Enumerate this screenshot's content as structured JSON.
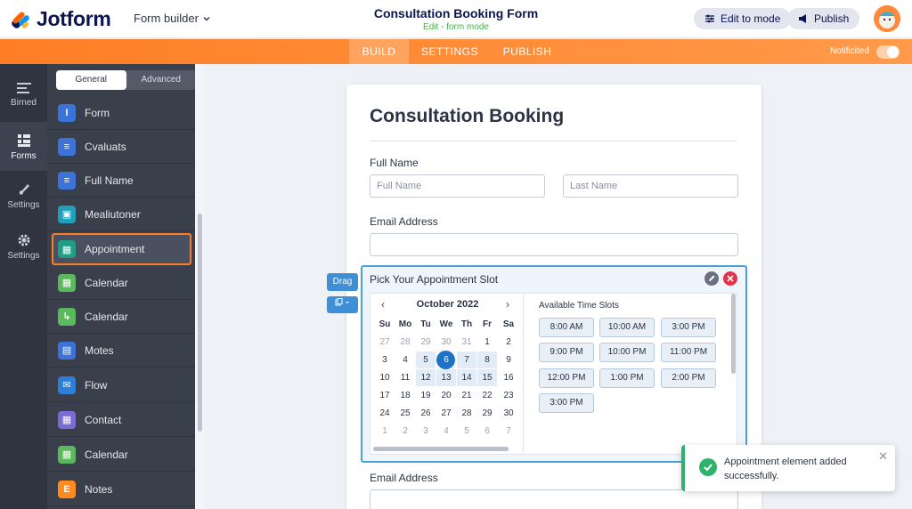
{
  "header": {
    "logo_text": "Jotform",
    "form_builder": "Form builder",
    "title": "Consultation Booking Form",
    "subtitle": "Edit - form mode",
    "edit_mode_button": "Edit to mode",
    "publish_button": "Publish"
  },
  "topbar": {
    "tabs": [
      "BUILD",
      "SETTINGS",
      "PUBLISH"
    ],
    "active_tab": "BUILD",
    "notification_label": "Notificited",
    "accent": "#ff7e25"
  },
  "rail": {
    "items": [
      "Birned",
      "Forms",
      "Settings",
      "Settings"
    ],
    "active": "Forms"
  },
  "panel": {
    "tabs": [
      "General",
      "Advanced"
    ],
    "active_tab": "General",
    "items": [
      {
        "label": "Form",
        "icon": "text-cursor-icon",
        "color": "#3b73d8",
        "glyph": "I"
      },
      {
        "label": "Cvaluats",
        "icon": "list-icon",
        "color": "#3b73d8",
        "glyph": "≡"
      },
      {
        "label": "Full Name",
        "icon": "lines-icon",
        "color": "#3b73d8",
        "glyph": "≡"
      },
      {
        "label": "Mealiutoner",
        "icon": "image-icon",
        "color": "#1ea0b8",
        "glyph": "▣"
      },
      {
        "label": "Appointment",
        "icon": "calendar-icon",
        "color": "#1f9e84",
        "glyph": "▦"
      },
      {
        "label": "Calendar",
        "icon": "calendar-icon",
        "color": "#5cb85c",
        "glyph": "▦"
      },
      {
        "label": "Calendar",
        "icon": "phone-icon",
        "color": "#5cb85c",
        "glyph": "↳"
      },
      {
        "label": "Motes",
        "icon": "note-icon",
        "color": "#3b73d8",
        "glyph": "▤"
      },
      {
        "label": "Flow",
        "icon": "mail-icon",
        "color": "#2e7fd8",
        "glyph": "✉"
      },
      {
        "label": "Contact",
        "icon": "calendar-check-icon",
        "color": "#7b6bd6",
        "glyph": "▦"
      },
      {
        "label": "Calendar",
        "icon": "calendar-icon",
        "color": "#5cb85c",
        "glyph": "▦"
      },
      {
        "label": "Notes",
        "icon": "letter-e-icon",
        "color": "#ff8a1e",
        "glyph": "E"
      }
    ],
    "selected": "Appointment"
  },
  "form": {
    "title": "Consultation Booking",
    "full_name_label": "Full Name",
    "first_placeholder": "Full Name",
    "last_placeholder": "Last Name",
    "email_label": "Email Address",
    "email_label_2": "Email Address"
  },
  "appointment": {
    "title": "Pick Your Appointment Slot",
    "drag_label": "Drag",
    "month": "October 2022",
    "weekdays": [
      "Su",
      "Mo",
      "Tu",
      "We",
      "Th",
      "Fr",
      "Sa"
    ],
    "weeks": [
      [
        "27",
        "28",
        "29",
        "30",
        "31",
        "1",
        "2"
      ],
      [
        "3",
        "4",
        "5",
        "6",
        "7",
        "8",
        "9"
      ],
      [
        "10",
        "11",
        "12",
        "13",
        "14",
        "15",
        "16"
      ],
      [
        "17",
        "18",
        "19",
        "20",
        "21",
        "22",
        "23"
      ],
      [
        "24",
        "25",
        "26",
        "27",
        "28",
        "29",
        "30"
      ],
      [
        "1",
        "2",
        "3",
        "4",
        "5",
        "6",
        "7"
      ]
    ],
    "selected_day": "6",
    "slots_title": "Available Time Slots",
    "slots": [
      "8:00 AM",
      "10:00 AM",
      "3:00 PM",
      "9:00 PM",
      "10:00 PM",
      "11:00 PM",
      "12:00 PM",
      "1:00 PM",
      "2:00 PM",
      "3:00 PM"
    ]
  },
  "toast": {
    "message": "Appointment element added successfully.",
    "accent": "#2fb36a"
  }
}
